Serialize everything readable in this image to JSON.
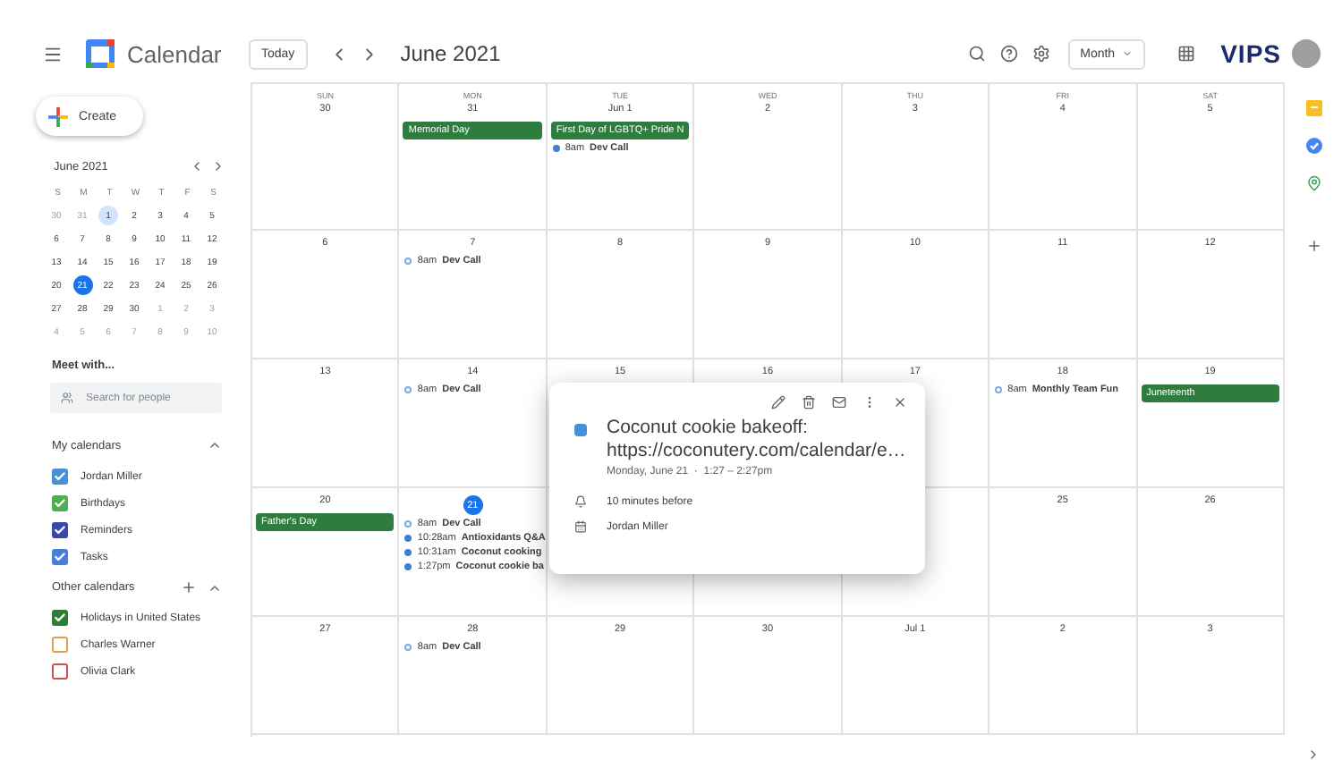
{
  "header": {
    "app_name": "Calendar",
    "today_button": "Today",
    "period": "June 2021",
    "view": "Month",
    "brand": "VIPS"
  },
  "create_button": "Create",
  "mini_calendar": {
    "title": "June 2021",
    "weekdays": [
      "S",
      "M",
      "T",
      "W",
      "T",
      "F",
      "S"
    ],
    "weeks": [
      [
        {
          "label": "30",
          "outside": true,
          "today": false,
          "selected": false
        },
        {
          "label": "31",
          "outside": true,
          "today": false,
          "selected": false
        },
        {
          "label": "1",
          "outside": false,
          "today": false,
          "selected": true
        },
        {
          "label": "2",
          "outside": false,
          "today": false,
          "selected": false
        },
        {
          "label": "3",
          "outside": false,
          "today": false,
          "selected": false
        },
        {
          "label": "4",
          "outside": false,
          "today": false,
          "selected": false
        },
        {
          "label": "5",
          "outside": false,
          "today": false,
          "selected": false
        }
      ],
      [
        {
          "label": "6",
          "outside": false,
          "today": false,
          "selected": false
        },
        {
          "label": "7",
          "outside": false,
          "today": false,
          "selected": false
        },
        {
          "label": "8",
          "outside": false,
          "today": false,
          "selected": false
        },
        {
          "label": "9",
          "outside": false,
          "today": false,
          "selected": false
        },
        {
          "label": "10",
          "outside": false,
          "today": false,
          "selected": false
        },
        {
          "label": "11",
          "outside": false,
          "today": false,
          "selected": false
        },
        {
          "label": "12",
          "outside": false,
          "today": false,
          "selected": false
        }
      ],
      [
        {
          "label": "13",
          "outside": false,
          "today": false,
          "selected": false
        },
        {
          "label": "14",
          "outside": false,
          "today": false,
          "selected": false
        },
        {
          "label": "15",
          "outside": false,
          "today": false,
          "selected": false
        },
        {
          "label": "16",
          "outside": false,
          "today": false,
          "selected": false
        },
        {
          "label": "17",
          "outside": false,
          "today": false,
          "selected": false
        },
        {
          "label": "18",
          "outside": false,
          "today": false,
          "selected": false
        },
        {
          "label": "19",
          "outside": false,
          "today": false,
          "selected": false
        }
      ],
      [
        {
          "label": "20",
          "outside": false,
          "today": false,
          "selected": false
        },
        {
          "label": "21",
          "outside": false,
          "today": true,
          "selected": false
        },
        {
          "label": "22",
          "outside": false,
          "today": false,
          "selected": false
        },
        {
          "label": "23",
          "outside": false,
          "today": false,
          "selected": false
        },
        {
          "label": "24",
          "outside": false,
          "today": false,
          "selected": false
        },
        {
          "label": "25",
          "outside": false,
          "today": false,
          "selected": false
        },
        {
          "label": "26",
          "outside": false,
          "today": false,
          "selected": false
        }
      ],
      [
        {
          "label": "27",
          "outside": false,
          "today": false,
          "selected": false
        },
        {
          "label": "28",
          "outside": false,
          "today": false,
          "selected": false
        },
        {
          "label": "29",
          "outside": false,
          "today": false,
          "selected": false
        },
        {
          "label": "30",
          "outside": false,
          "today": false,
          "selected": false
        },
        {
          "label": "1",
          "outside": true,
          "today": false,
          "selected": false
        },
        {
          "label": "2",
          "outside": true,
          "today": false,
          "selected": false
        },
        {
          "label": "3",
          "outside": true,
          "today": false,
          "selected": false
        }
      ],
      [
        {
          "label": "4",
          "outside": true,
          "today": false,
          "selected": false
        },
        {
          "label": "5",
          "outside": true,
          "today": false,
          "selected": false
        },
        {
          "label": "6",
          "outside": true,
          "today": false,
          "selected": false
        },
        {
          "label": "7",
          "outside": true,
          "today": false,
          "selected": false
        },
        {
          "label": "8",
          "outside": true,
          "today": false,
          "selected": false
        },
        {
          "label": "9",
          "outside": true,
          "today": false,
          "selected": false
        },
        {
          "label": "10",
          "outside": true,
          "today": false,
          "selected": false
        }
      ]
    ]
  },
  "meet_with": {
    "title": "Meet with...",
    "placeholder": "Search for people"
  },
  "my_calendars": {
    "title": "My calendars",
    "items": [
      {
        "label": "Jordan Miller",
        "checked": true,
        "color": "#4a90d9"
      },
      {
        "label": "Birthdays",
        "checked": true,
        "color": "#4caf50"
      },
      {
        "label": "Reminders",
        "checked": true,
        "color": "#3949ab"
      },
      {
        "label": "Tasks",
        "checked": true,
        "color": "#4a7fd9"
      }
    ]
  },
  "other_calendars": {
    "title": "Other calendars",
    "items": [
      {
        "label": "Holidays in United States",
        "checked": true,
        "color": "#2e7d32"
      },
      {
        "label": "Charles Warner",
        "checked": false,
        "color": "#e0a050"
      },
      {
        "label": "Olivia Clark",
        "checked": false,
        "color": "#d05050"
      }
    ]
  },
  "month": {
    "weekdays": [
      "SUN",
      "MON",
      "TUE",
      "WED",
      "THU",
      "FRI",
      "SAT"
    ],
    "weeks": [
      [
        {
          "label": "30"
        },
        {
          "label": "31",
          "events": [
            {
              "kind": "allday",
              "title": "Memorial Day"
            }
          ]
        },
        {
          "label": "Jun 1",
          "events": [
            {
              "kind": "allday",
              "title": "First Day of LGBTQ+ Pride N"
            },
            {
              "kind": "timed",
              "time": "8am",
              "title": "Dev Call"
            }
          ]
        },
        {
          "label": "2"
        },
        {
          "label": "3"
        },
        {
          "label": "4"
        },
        {
          "label": "5"
        }
      ],
      [
        {
          "label": "6"
        },
        {
          "label": "7",
          "events": [
            {
              "kind": "invited",
              "time": "8am",
              "title": "Dev Call"
            }
          ]
        },
        {
          "label": "8"
        },
        {
          "label": "9"
        },
        {
          "label": "10"
        },
        {
          "label": "11"
        },
        {
          "label": "12"
        }
      ],
      [
        {
          "label": "13"
        },
        {
          "label": "14",
          "events": [
            {
              "kind": "invited",
              "time": "8am",
              "title": "Dev Call"
            }
          ]
        },
        {
          "label": "15"
        },
        {
          "label": "16"
        },
        {
          "label": "17"
        },
        {
          "label": "18",
          "events": [
            {
              "kind": "invited",
              "time": "8am",
              "title": "Monthly Team Fun"
            }
          ]
        },
        {
          "label": "19",
          "events": [
            {
              "kind": "allday",
              "title": "Juneteenth"
            }
          ]
        }
      ],
      [
        {
          "label": "20",
          "events": [
            {
              "kind": "allday",
              "title": "Father's Day"
            }
          ]
        },
        {
          "label": "21",
          "today": true,
          "events": [
            {
              "kind": "invited",
              "time": "8am",
              "title": "Dev Call"
            },
            {
              "kind": "timed",
              "time": "10:28am",
              "title": "Antioxidants Q&A"
            },
            {
              "kind": "timed",
              "time": "10:31am",
              "title": "Coconut cooking"
            },
            {
              "kind": "timed",
              "time": "1:27pm",
              "title": "Coconut cookie ba"
            }
          ]
        },
        {
          "label": "25"
        },
        {
          "label": "26"
        }
      ],
      [
        {
          "label": "27"
        },
        {
          "label": "28",
          "events": [
            {
              "kind": "invited",
              "time": "8am",
              "title": "Dev Call"
            }
          ]
        },
        {
          "label": "29"
        },
        {
          "label": "30"
        },
        {
          "label": "Jul 1"
        },
        {
          "label": "2"
        },
        {
          "label": "3"
        }
      ]
    ]
  },
  "popup": {
    "color": "#4a90d9",
    "title": "Coconut cookie bakeoff: https://coconutery.com/calendar/e…",
    "when": "Monday, June 21  ·  1:27 – 2:27pm",
    "reminder": "10 minutes before",
    "calendar": "Jordan Miller"
  }
}
